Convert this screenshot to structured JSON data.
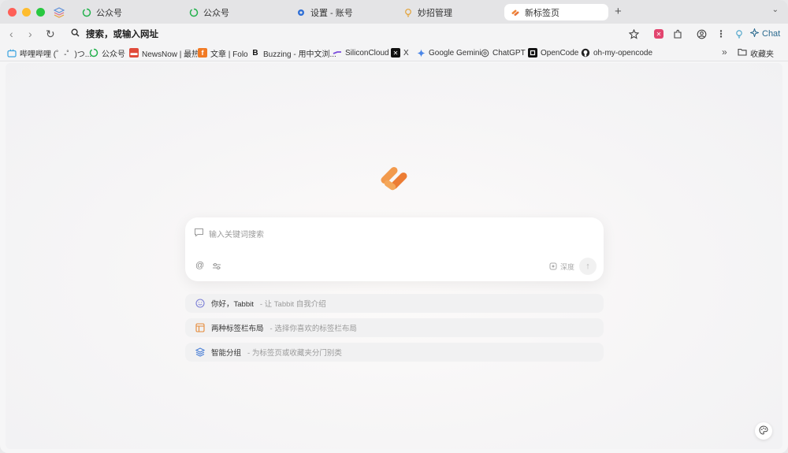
{
  "tabs": [
    {
      "label": "公众号",
      "icon": "wechat-official-icon"
    },
    {
      "label": "公众号",
      "icon": "wechat-official-icon"
    },
    {
      "label": "设置 - 账号",
      "icon": "gear-icon"
    },
    {
      "label": "妙招管理",
      "icon": "lightbulb-icon"
    },
    {
      "label": "新标签页",
      "icon": "tabbit-logo-icon",
      "active": true
    }
  ],
  "new_tab_symbol": "+",
  "tab_menu_symbol": "⌄",
  "toolbar": {
    "back_symbol": "‹",
    "forward_symbol": "›",
    "reload_symbol": "↻",
    "search_symbol": "🔍",
    "address_placeholder": "搜索，或输入网址",
    "chat_label": "Chat"
  },
  "bookmarks": [
    {
      "label": "哔哩哔哩 (゜-゜)つ...",
      "icon": "bilibili-icon"
    },
    {
      "label": "公众号",
      "icon": "wechat-official-icon"
    },
    {
      "label": "NewsNow | 最热",
      "icon": "newsnow-icon"
    },
    {
      "label": "文章 | Folo",
      "icon": "folo-icon"
    },
    {
      "label": "Buzzing - 用中文浏...",
      "icon": "buzzing-icon"
    },
    {
      "label": "SiliconCloud",
      "icon": "siliconcloud-icon"
    },
    {
      "label": "X",
      "icon": "x-icon"
    },
    {
      "label": "Google Gemini",
      "icon": "gemini-icon"
    },
    {
      "label": "ChatGPT",
      "icon": "chatgpt-icon"
    },
    {
      "label": "OpenCode",
      "icon": "opencode-icon"
    },
    {
      "label": "oh-my-opencode",
      "icon": "github-icon"
    }
  ],
  "bookmarks_more_symbol": "»",
  "bookmarks_folder_label": "收藏夹",
  "search": {
    "placeholder": "输入关键词搜索",
    "at_symbol": "@",
    "think_label": "深度",
    "send_symbol": "↑"
  },
  "suggestions": [
    {
      "title": "你好，Tabbit",
      "desc": " - 让 Tabbit 自我介绍",
      "icon": "smile-icon"
    },
    {
      "title": "两种标签栏布局",
      "desc": " - 选择你喜欢的标签栏布局",
      "icon": "layout-icon"
    },
    {
      "title": "智能分组",
      "desc": " - 为标签页或收藏夹分门别类",
      "icon": "layers-icon"
    }
  ],
  "colors": {
    "brand_orange": "#f0883a",
    "active_tab": "#ffffff"
  }
}
